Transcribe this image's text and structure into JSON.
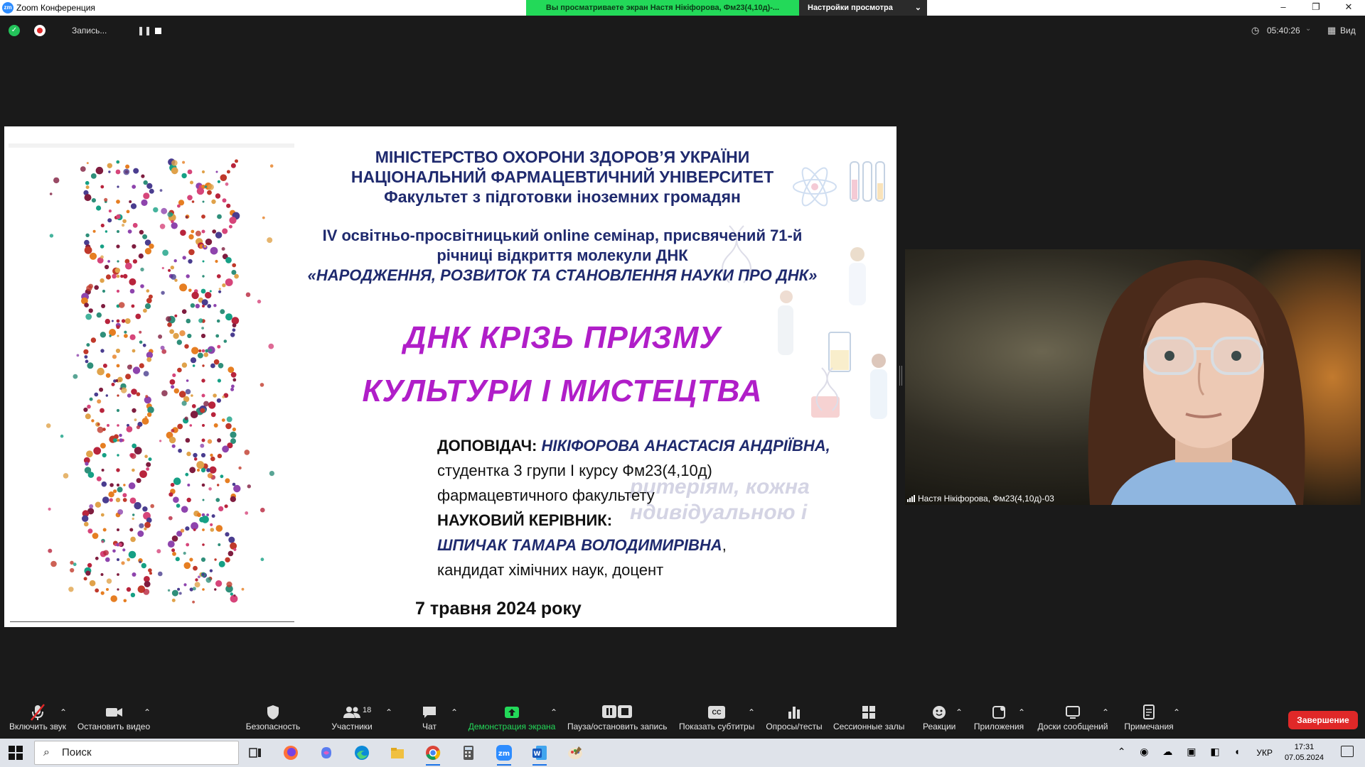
{
  "window": {
    "app_icon_text": "zm",
    "title": "Zoom Конференция",
    "controls": {
      "minimize": "–",
      "restore": "❐",
      "close": "✕"
    }
  },
  "view_banner": {
    "text": "Вы просматриваете экран Настя Нікіфорова, Фм23(4,10д)-...",
    "settings_label": "Настройки просмотра",
    "settings_chevron": "⌄"
  },
  "meeting_bar": {
    "recording_label": "Запись...",
    "pause_glyph": "❚❚",
    "timer": "05:40:26",
    "view_label": "Вид",
    "security_icon": "shield-check-icon",
    "timer_icon": "clock-icon",
    "caret": "⌄"
  },
  "slide": {
    "header_lines": [
      "МІНІСТЕРСТВО ОХОРОНИ  ЗДОРОВ’Я УКРАЇНИ",
      "НАЦІОНАЛЬНИЙ ФАРМАЦЕВТИЧНИЙ УНІВЕРСИТЕТ",
      "Факультет з підготовки іноземних громадян"
    ],
    "seminar_line1": "IV освітньо-просвітницький online семінар, присвячений 71-й",
    "seminar_line2": "річниці відкриття молекули ДНК",
    "seminar_title": "«НАРОДЖЕННЯ, РОЗВИТОК ТА СТАНОВЛЕННЯ НАУКИ ПРО ДНК»",
    "topic_line1": "ДНК КРІЗЬ ПРИЗМУ",
    "topic_line2": "КУЛЬТУРИ І МИСТЕЦТВА",
    "speaker_label": "ДОПОВІДАЧ:",
    "speaker_name": "НІКІФОРОВА АНАСТАСІЯ АНДРІЇВНА,",
    "speaker_desc1": "студентка 3 групи І курсу Фм23(4,10д)",
    "speaker_desc2": "фармацевтичного факультету",
    "supervisor_label": "НАУКОВИЙ КЕРІВНИК:",
    "supervisor_name": "ШПИЧАК ТАМАРА ВОЛОДИМИРІВНА",
    "supervisor_comma": ",",
    "supervisor_desc": "кандидат хімічних наук, доцент",
    "ghost_line1": "ритеріям,   кожна",
    "ghost_line2": "ндивідуальною      і",
    "date": "7 травня 2024 року"
  },
  "video": {
    "participant_name": "Настя Нікіфорова, Фм23(4,10д)-03"
  },
  "toolbar": {
    "unmute": "Включить звук",
    "stop_video": "Остановить видео",
    "security": "Безопасность",
    "participants": "Участники",
    "participants_count": "18",
    "chat": "Чат",
    "share_screen": "Демонстрация экрана",
    "pause_recording": "Пауза/остановить запись",
    "captions": "Показать субтитры",
    "captions_badge": "CC",
    "polls": "Опросы/тесты",
    "breakout": "Сессионные залы",
    "reactions": "Реакции",
    "apps": "Приложения",
    "whiteboards": "Доски сообщений",
    "notes": "Примечания",
    "end": "Завершение",
    "caret": "⌃",
    "accent_green": "#23d959",
    "end_red": "#e02828"
  },
  "taskbar": {
    "search_placeholder": "Поиск",
    "language": "УКР",
    "time": "17:31",
    "date": "07.05.2024",
    "apps": [
      "task-view-icon",
      "firefox-icon",
      "copilot-icon",
      "edge-icon",
      "file-explorer-icon",
      "chrome-icon",
      "calculator-icon",
      "zoom-icon",
      "word-icon",
      "paint-icon"
    ]
  }
}
